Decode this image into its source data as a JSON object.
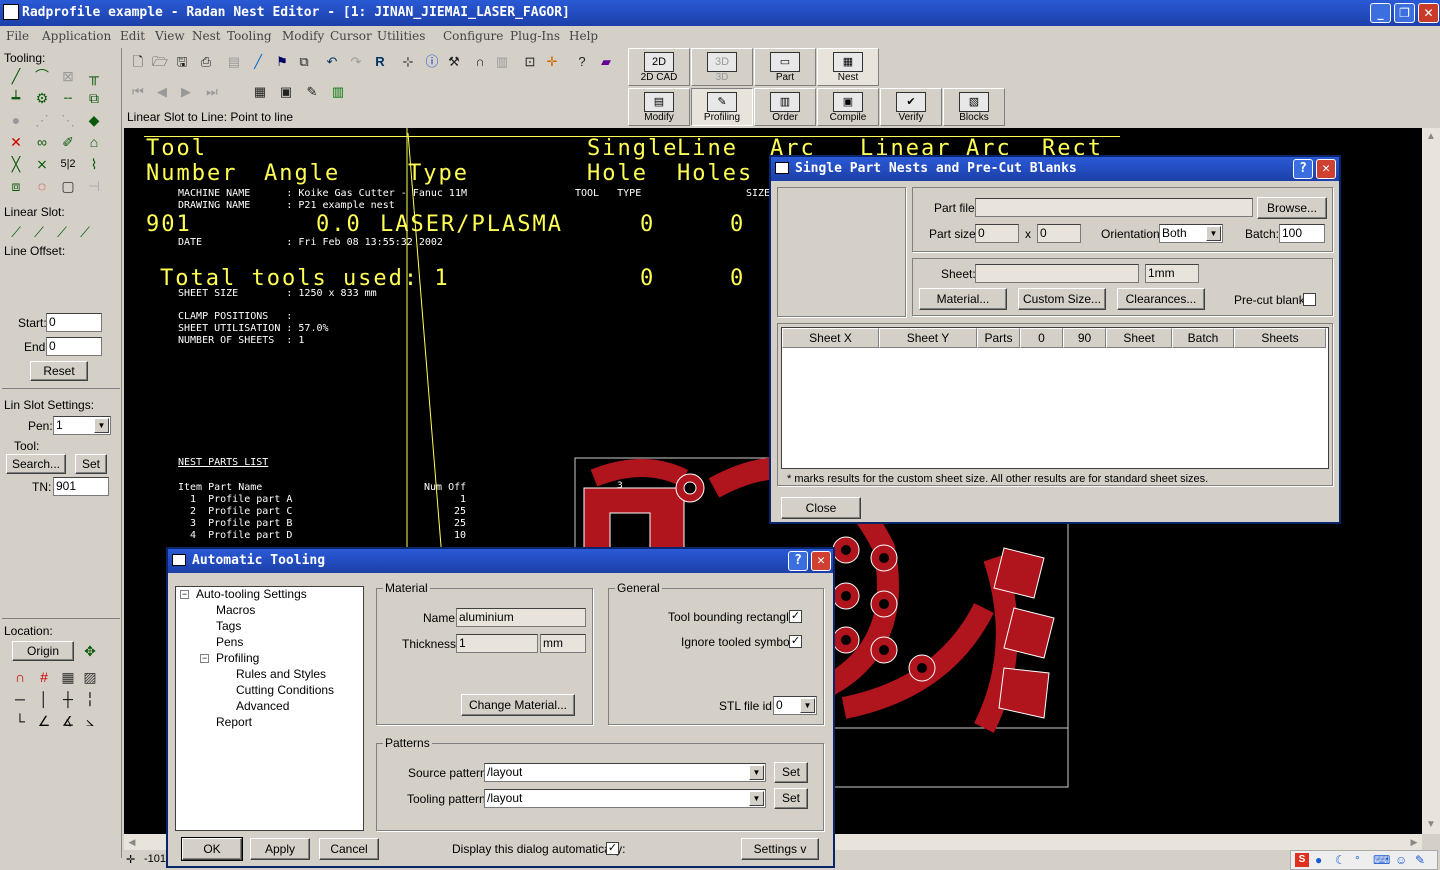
{
  "window": {
    "title": "Radprofile example - Radan Nest Editor - [1: JINAN_JIEMAI_LASER_FAGOR]"
  },
  "menu": [
    "File",
    "Application",
    "Edit",
    "View",
    "Nest",
    "Tooling",
    "Modify",
    "Cursor",
    "Utilities",
    "Configure",
    "Plug-Ins",
    "Help"
  ],
  "left": {
    "tooling_label": "Tooling:",
    "linear_slot_label": "Linear Slot:",
    "line_offset_label": "Line Offset:",
    "start_label": "Start:",
    "start_value": "0",
    "end_label": "End:",
    "end_value": "0",
    "reset": "Reset",
    "lin_slot_settings": "Lin Slot Settings:",
    "pen_label": "Pen:",
    "pen_value": "1",
    "tool_label": "Tool:",
    "search": "Search...",
    "set": "Set",
    "tn_label": "TN:",
    "tn_value": "901",
    "location_label": "Location:",
    "origin": "Origin"
  },
  "toolbar": {
    "status_text": "Linear Slot to Line: Point to line",
    "big_buttons": [
      {
        "label": "2D CAD",
        "icon": "2D"
      },
      {
        "label": "3D",
        "icon": "3D"
      },
      {
        "label": "Part",
        "icon": "▭"
      },
      {
        "label": "Nest",
        "icon": "▦"
      },
      {
        "label": "Modify",
        "icon": "▤"
      },
      {
        "label": "Profiling",
        "icon": "✎"
      },
      {
        "label": "Order",
        "icon": "▥"
      },
      {
        "label": "Compile",
        "icon": "▣"
      },
      {
        "label": "Verify",
        "icon": "✔"
      },
      {
        "label": "Blocks",
        "icon": "▧"
      }
    ]
  },
  "canvas": {
    "h_tool": "Tool",
    "h_number": "Number",
    "h_angle": "Angle",
    "h_type": "Type",
    "h_single": "Single",
    "h_hole": "Hole",
    "h_line": "Line",
    "h_holes": "Holes",
    "h_arc1": "Arc",
    "h_linear": "Linear",
    "h_arc2": "Arc",
    "h_rect": "Rect",
    "row_number": "901",
    "row_angle": "0.0",
    "row_type": "LASER/PLASMA",
    "row_v1": "0",
    "row_v2": "0",
    "total_label": "Total tools used: 1",
    "total_v1": "0",
    "total_v2": "0",
    "machine_name": "MACHINE NAME      : Koike Gas Cutter - Fanuc 11M",
    "drawing_name": "DRAWING NAME      : P21 example nest",
    "tool_type": "TOOL   TYPE",
    "size": "SIZE",
    "date": "DATE              : Fri Feb 08 13:55:32 2002",
    "sheet_size": "SHEET SIZE        : 1250 x 833 mm",
    "clamp": "CLAMP POSITIONS   :",
    "utilisation": "SHEET UTILISATION : 57.0%",
    "num_sheets": "NUMBER OF SHEETS  : 1",
    "nest_parts_title": "NEST PARTS LIST",
    "parts_header": "Item Part Name",
    "num_off": "Num Off",
    "parts": [
      {
        "name": "  1  Profile part A",
        "qty": "1"
      },
      {
        "name": "  2  Profile part C",
        "qty": "25"
      },
      {
        "name": "  3  Profile part B",
        "qty": "25"
      },
      {
        "name": "  4  Profile part D",
        "qty": "10"
      }
    ],
    "part_mark": "3"
  },
  "spn_dialog": {
    "title": "Single Part Nests and Pre-Cut Blanks",
    "part_file_label": "Part file:",
    "part_file_value": "",
    "browse": "Browse...",
    "part_size_label": "Part size:",
    "part_size_x": "0",
    "part_size_y": "0",
    "x_sep": "x",
    "orientation_label": "Orientation:",
    "orientation_value": "Both",
    "batch_label": "Batch:",
    "batch_value": "100",
    "sheet_label": "Sheet:",
    "sheet_value": "",
    "sheet_units": "1mm",
    "material_btn": "Material...",
    "custom_size_btn": "Custom Size...",
    "clearances_btn": "Clearances...",
    "precut_label": "Pre-cut blank:",
    "columns": [
      "Sheet X",
      "Sheet Y",
      "Parts",
      "0",
      "90",
      "Sheet",
      "Batch",
      "Sheets"
    ],
    "note": "* marks results for the custom sheet size. All other results are for standard sheet sizes.",
    "close": "Close"
  },
  "at_dialog": {
    "title": "Automatic Tooling",
    "tree": [
      "Auto-tooling Settings",
      "Macros",
      "Tags",
      "Pens",
      "Profiling",
      "Rules and Styles",
      "Cutting Conditions",
      "Advanced",
      "Report"
    ],
    "material_group": "Material",
    "name_label": "Name:",
    "name_value": "aluminium",
    "thickness_label": "Thickness:",
    "thickness_value": "1",
    "thickness_units": "mm",
    "change_material": "Change Material...",
    "general_group": "General",
    "tool_bounding": "Tool bounding rectangle:",
    "ignore_tooled": "Ignore tooled symbols:",
    "stl_label": "STL file id:",
    "stl_value": "0",
    "patterns_group": "Patterns",
    "source_label": "Source pattern:",
    "source_value": "/layout",
    "tooling_label": "Tooling pattern:",
    "tooling_value": "/layout",
    "set": "Set",
    "ok": "OK",
    "apply": "Apply",
    "cancel": "Cancel",
    "display_auto": "Display this dialog automatically:",
    "settings": "Settings  v"
  },
  "status": {
    "coord": "-101"
  }
}
